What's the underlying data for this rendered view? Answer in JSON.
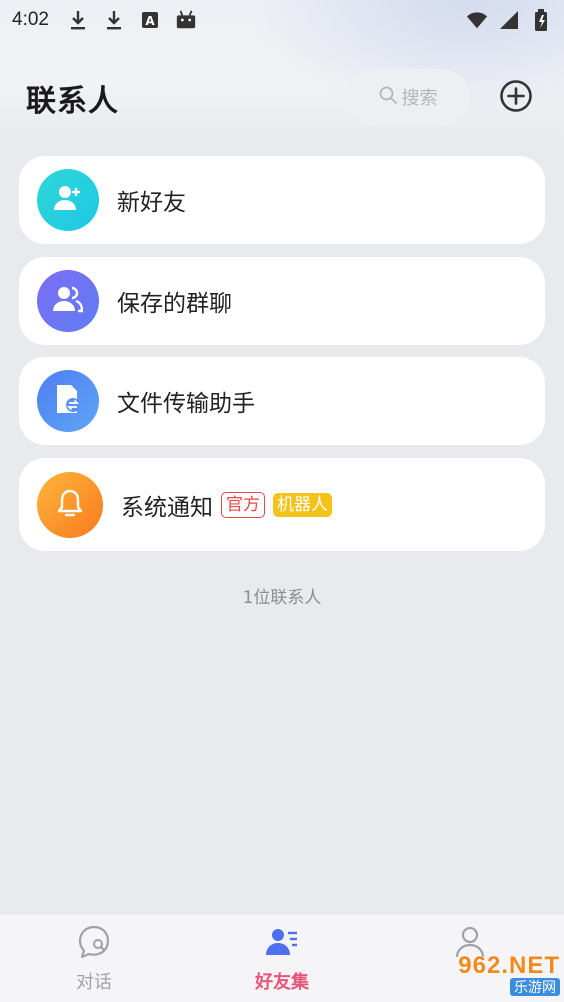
{
  "status_bar": {
    "time": "4:02",
    "left_icons": [
      "download-icon",
      "download-icon",
      "text-a-icon",
      "android-icon"
    ],
    "right_icons": [
      "wifi-icon",
      "signal-icon",
      "battery-icon"
    ]
  },
  "header": {
    "title": "联系人",
    "search_placeholder": "搜索",
    "add_icon": "plus-circle-icon"
  },
  "contacts": {
    "items": [
      {
        "label": "新好友",
        "icon": "add-user-icon",
        "color_from": "#2fd6d6",
        "color_to": "#1ec8e6"
      },
      {
        "label": "保存的群聊",
        "icon": "group-icon",
        "color_from": "#7d6ef5",
        "color_to": "#5f7cf2"
      },
      {
        "label": "文件传输助手",
        "icon": "file-transfer-icon",
        "color_from": "#4f7ef2",
        "color_to": "#5fa6f6"
      },
      {
        "label": "系统通知",
        "icon": "bell-icon",
        "color_from": "#ffb53c",
        "color_to": "#f77a1e",
        "tags": [
          "官方",
          "机器人"
        ]
      }
    ],
    "count_text": "1位联系人"
  },
  "bottom_nav": {
    "items": [
      {
        "label": "对话",
        "icon": "chat-icon",
        "active": false
      },
      {
        "label": "好友集",
        "icon": "contacts-icon",
        "active": true
      },
      {
        "label": "",
        "icon": "profile-icon",
        "active": false
      }
    ],
    "active_color": "#e8557a"
  },
  "watermark": {
    "main": "962.NET",
    "sub": "乐游网"
  }
}
